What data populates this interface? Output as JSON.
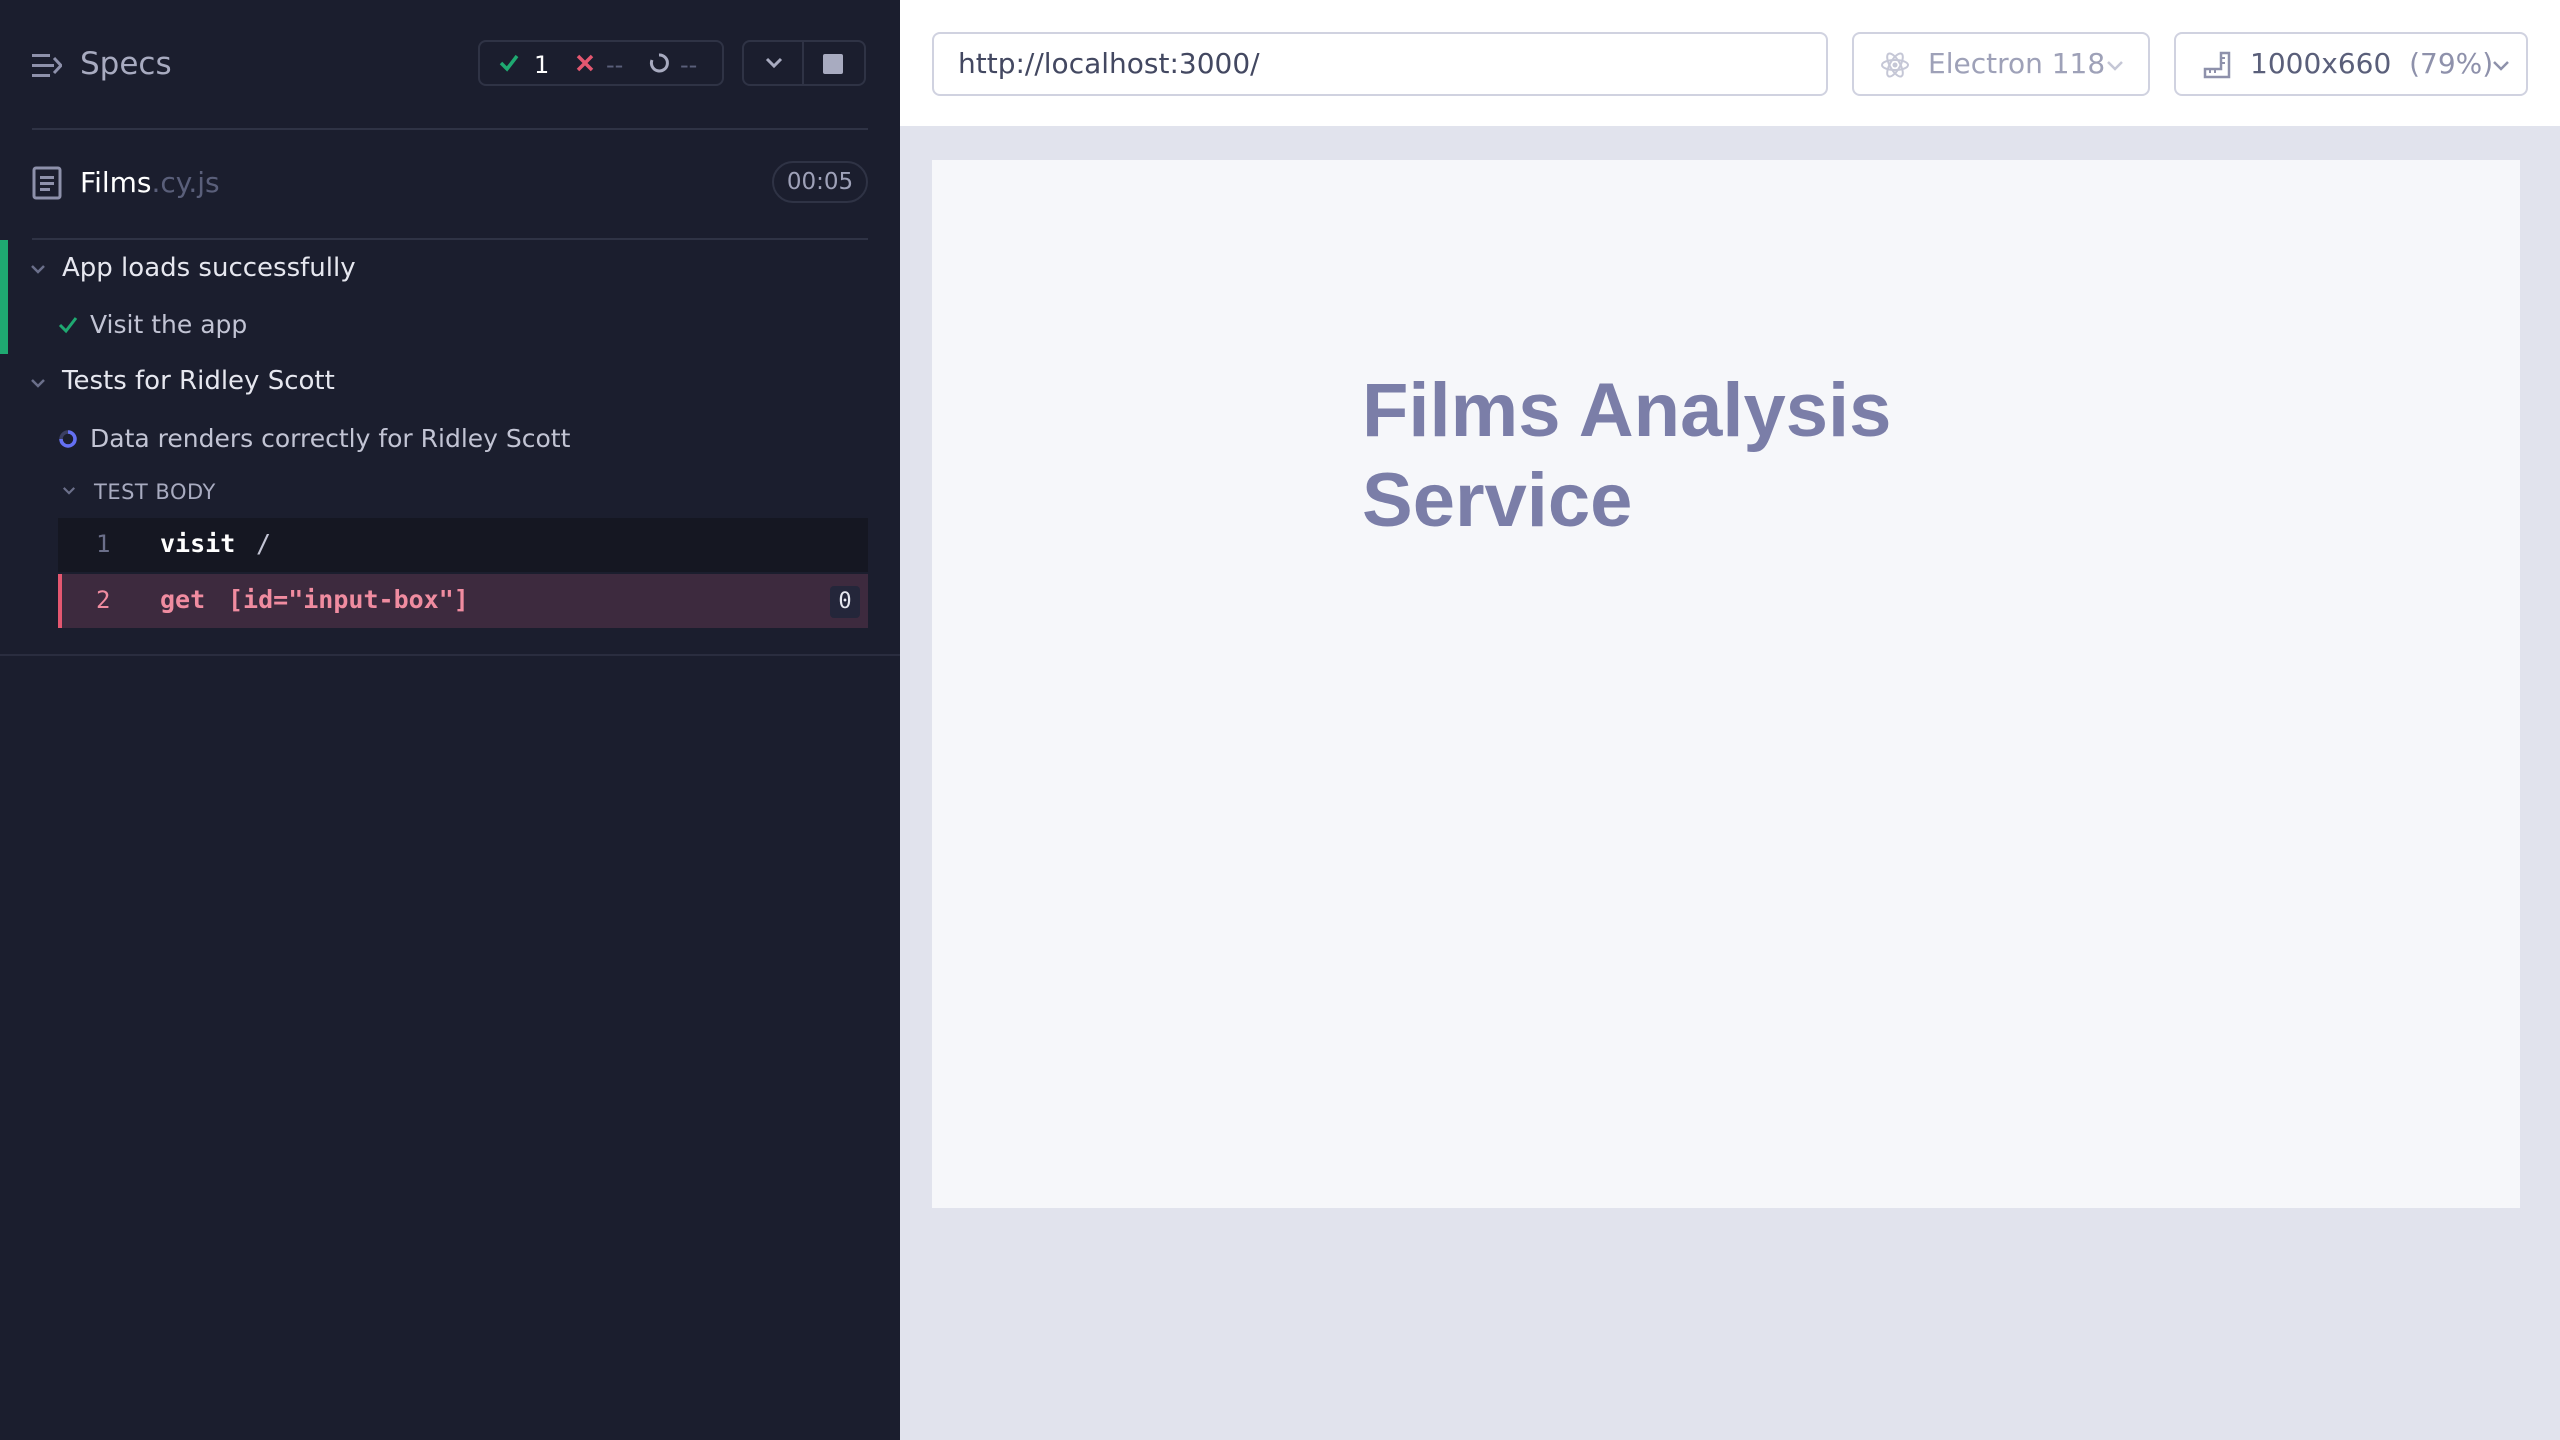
{
  "sidebar": {
    "title": "Specs",
    "stats": {
      "passed": "1",
      "failed": "--",
      "pending": "--"
    },
    "spec_file": {
      "name": "Films",
      "ext": ".cy.js",
      "duration": "00:05"
    },
    "suites": [
      {
        "title": "App loads successfully",
        "tests": [
          {
            "title": "Visit the app",
            "state": "passed"
          }
        ]
      },
      {
        "title": "Tests for Ridley Scott",
        "tests": [
          {
            "title": "Data renders correctly for Ridley Scott",
            "state": "running"
          }
        ]
      }
    ],
    "section_label": "TEST BODY",
    "commands": [
      {
        "num": "1",
        "name": "visit",
        "arg": "/"
      },
      {
        "num": "2",
        "name": "get",
        "arg": "[id=\"input-box\"]",
        "badge": "0"
      }
    ]
  },
  "toolbar": {
    "url": "http://localhost:3000/",
    "browser": "Electron 118",
    "viewport": "1000x660",
    "scale": "(79%)"
  },
  "app": {
    "title_line1": "Films Analysis",
    "title_line2": "Service"
  },
  "colors": {
    "pass": "#1fa971",
    "fail": "#e45770",
    "running": "#6470f3",
    "app_title": "#7b7ea8"
  }
}
